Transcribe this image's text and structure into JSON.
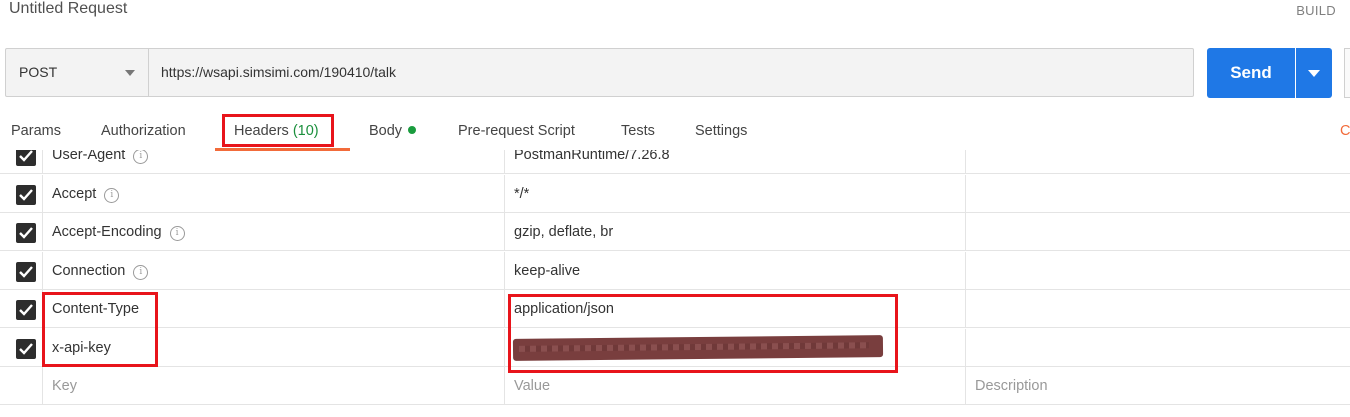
{
  "request": {
    "title": "Untitled Request",
    "build_label": "BUILD"
  },
  "urlbar": {
    "method": "POST",
    "url": "https://wsapi.simsimi.com/190410/talk"
  },
  "send": {
    "label": "Send"
  },
  "tabs": {
    "params": "Params",
    "authorization": "Authorization",
    "headers": "Headers",
    "headers_count": "(10)",
    "body": "Body",
    "pre_request": "Pre-request Script",
    "tests": "Tests",
    "settings": "Settings",
    "cut_off": "C"
  },
  "headers": [
    {
      "key": "User-Agent",
      "value": "PostmanRuntime/7.26.8",
      "checked": true,
      "info": true
    },
    {
      "key": "Accept",
      "value": "*/*",
      "checked": true,
      "info": true
    },
    {
      "key": "Accept-Encoding",
      "value": "gzip, deflate, br",
      "checked": true,
      "info": true
    },
    {
      "key": "Connection",
      "value": "keep-alive",
      "checked": true,
      "info": true
    },
    {
      "key": "Content-Type",
      "value": "application/json",
      "checked": true,
      "info": false
    },
    {
      "key": "x-api-key",
      "value": "",
      "checked": true,
      "info": false,
      "redacted": true
    }
  ],
  "new_row": {
    "key_placeholder": "Key",
    "value_placeholder": "Value",
    "description_placeholder": "Description"
  },
  "colors": {
    "send": "#1f78e6",
    "active_tab": "#f26b3a",
    "highlight": "#e8141b",
    "body_dot": "#1a9c3e"
  }
}
